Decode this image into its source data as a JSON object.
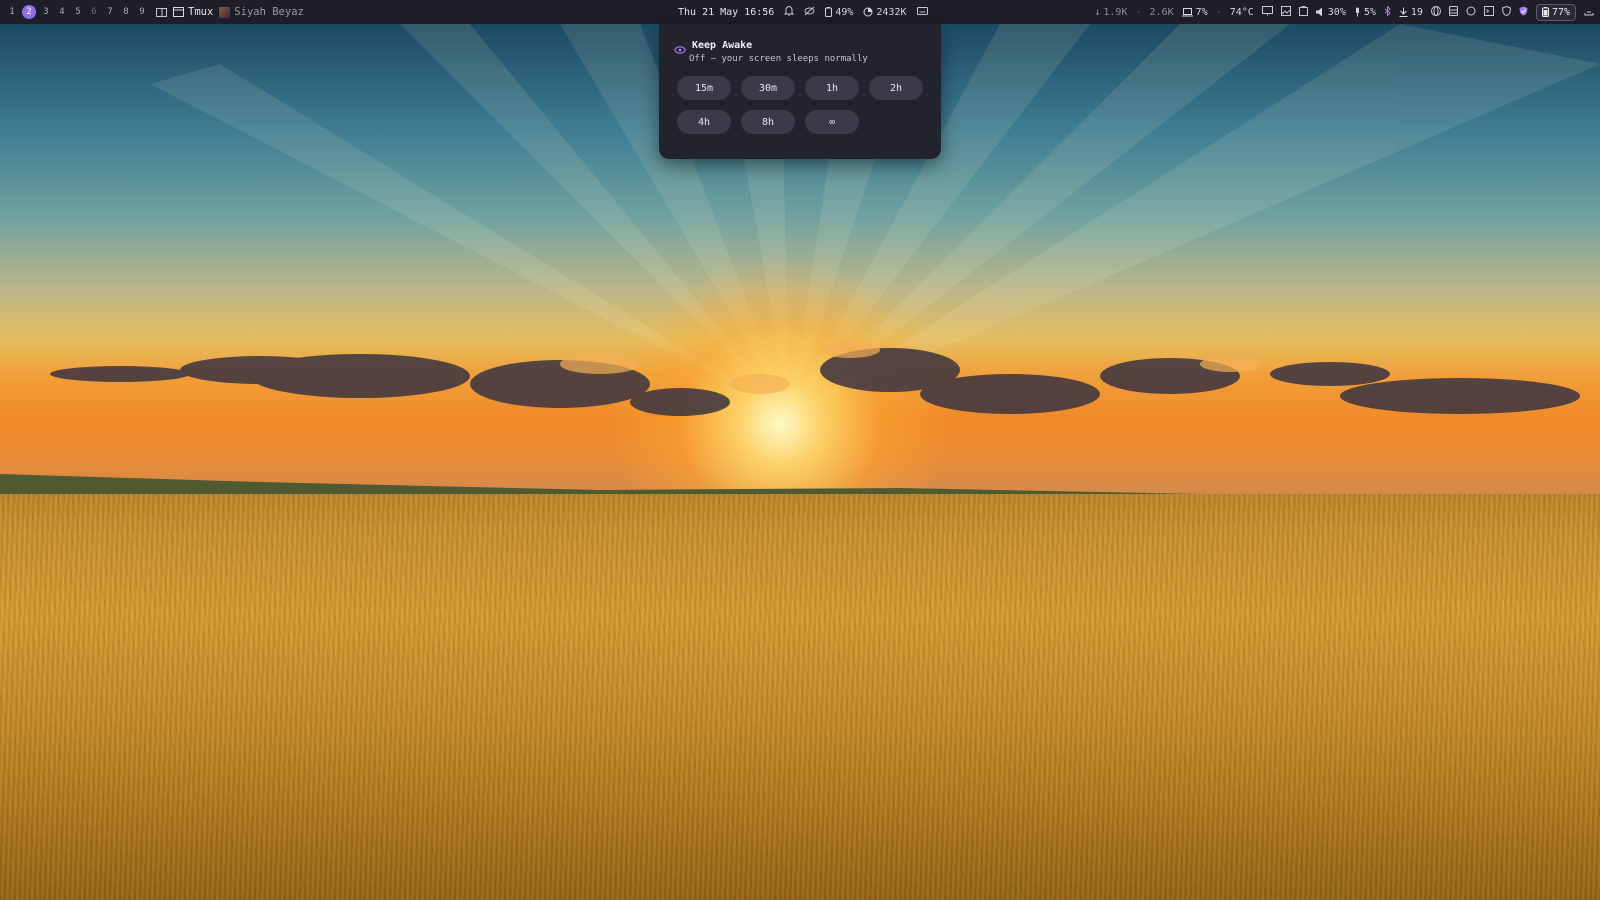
{
  "topbar": {
    "workspaces": [
      "1",
      "2",
      "3",
      "4",
      "5",
      "6",
      "7",
      "8",
      "9"
    ],
    "active_workspace": "2",
    "window_title": "Tmux",
    "media_title": "Siyah Beyaz",
    "datetime": "Thu 21 May 16:56",
    "battery_center": "49%",
    "memory": "2432K",
    "net_down": "1.9K",
    "net_up": "2.6K",
    "cpu": "7%",
    "temperature": "74°C",
    "volume": "30%",
    "mic": "5%",
    "updates": "19",
    "battery": "77%"
  },
  "popup": {
    "title": "Keep Awake",
    "subtitle": "Off — your screen sleeps normally",
    "options": [
      "15m",
      "30m",
      "1h",
      "2h",
      "4h",
      "8h",
      "∞"
    ]
  },
  "colors": {
    "bar_bg": "#1e1e28",
    "accent": "#8f6ee0",
    "popup_bg": "#23232e",
    "button_bg": "#3a3a48"
  }
}
